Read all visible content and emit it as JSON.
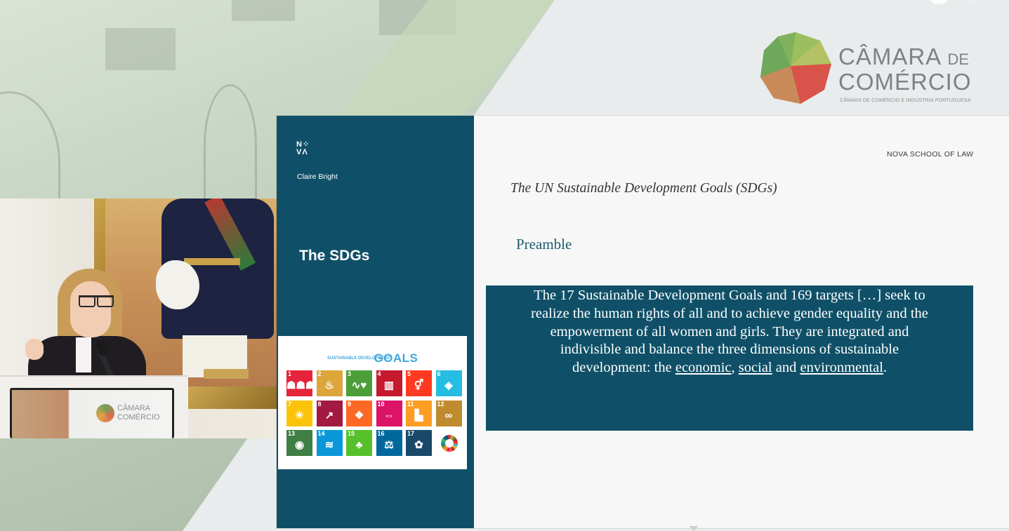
{
  "logo": {
    "word1": "CÂMARA",
    "word1_suffix": "DE",
    "word2": "COMÉRCIO",
    "subtitle": "CÂMARA DE COMÉRCIO E INDÚSTRIA PORTUGUESA"
  },
  "lectern_logo": {
    "line1": "CÂMARA",
    "line2": "COMÉRCIO"
  },
  "slide": {
    "nova_logo_line1": "N⁘",
    "nova_logo_line2": "VΛ",
    "presenter": "Claire Bright",
    "section_title": "The SDGs",
    "school": "NOVA SCHOOL OF LAW",
    "title": "The UN Sustainable Development Goals (SDGs)",
    "subtitle": "Preamble",
    "quote": {
      "line1": "The 17 Sustainable Development Goals and 169 targets […] seek to",
      "line2": "realize the human rights of all and to achieve gender equality and the",
      "line3": "empowerment of all women and girls. They are integrated and",
      "line4": "indivisible and balance the three dimensions of sustainable",
      "line5_prefix": "development: the ",
      "economic": "economic",
      "comma": ", ",
      "social": "social",
      "and": " and ",
      "environmental": "environmental",
      "period": "."
    },
    "sdg": {
      "heading_small": "SUSTAINABLE DEVELOPMENT",
      "heading_big": "GOALS",
      "tiles": [
        {
          "num": "1",
          "glyph": "☗☗☗",
          "color": "#e5243b"
        },
        {
          "num": "2",
          "glyph": "♨",
          "color": "#dda63a"
        },
        {
          "num": "3",
          "glyph": "∿♥",
          "color": "#4c9f38"
        },
        {
          "num": "4",
          "glyph": "▥",
          "color": "#c5192d"
        },
        {
          "num": "5",
          "glyph": "⚥",
          "color": "#ff3a21"
        },
        {
          "num": "6",
          "glyph": "◈",
          "color": "#26bde2"
        },
        {
          "num": "7",
          "glyph": "☀",
          "color": "#fcc30b"
        },
        {
          "num": "8",
          "glyph": "↗",
          "color": "#a21942"
        },
        {
          "num": "9",
          "glyph": "❖",
          "color": "#fd6925"
        },
        {
          "num": "10",
          "glyph": "⇔",
          "color": "#dd1367"
        },
        {
          "num": "11",
          "glyph": "▙",
          "color": "#fd9d24"
        },
        {
          "num": "12",
          "glyph": "∞",
          "color": "#bf8b2e"
        },
        {
          "num": "13",
          "glyph": "◉",
          "color": "#3f7e44"
        },
        {
          "num": "14",
          "glyph": "≋",
          "color": "#0a97d9"
        },
        {
          "num": "15",
          "glyph": "♣",
          "color": "#56c02b"
        },
        {
          "num": "16",
          "glyph": "⚖",
          "color": "#00689d"
        },
        {
          "num": "17",
          "glyph": "✿",
          "color": "#19486a"
        }
      ]
    }
  },
  "player": {
    "arrow": "↗"
  },
  "colors": {
    "slide_teal": "#0f5068",
    "sdg_blue": "#3fa7dc"
  }
}
